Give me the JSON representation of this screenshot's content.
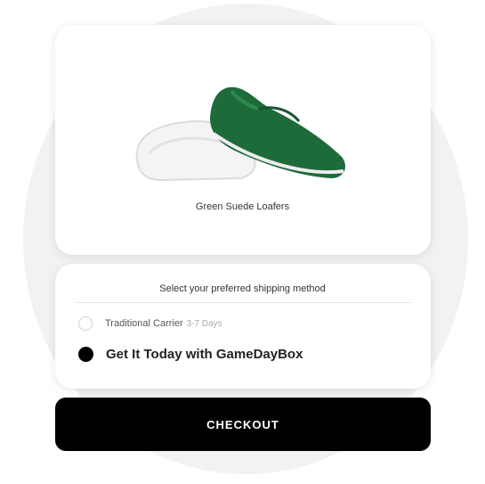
{
  "product": {
    "name": "Green Suede Loafers",
    "image_icon": "green-loafer-shoe",
    "shoe_color": "#1e6b3a"
  },
  "shipping": {
    "title": "Select your preferred shipping method",
    "options": [
      {
        "label": "Traditional Carrier",
        "detail": "3-7 Days",
        "selected": false
      },
      {
        "label": "Get It Today with GameDayBox",
        "selected": true
      }
    ]
  },
  "checkout": {
    "label": "CHECKOUT"
  }
}
